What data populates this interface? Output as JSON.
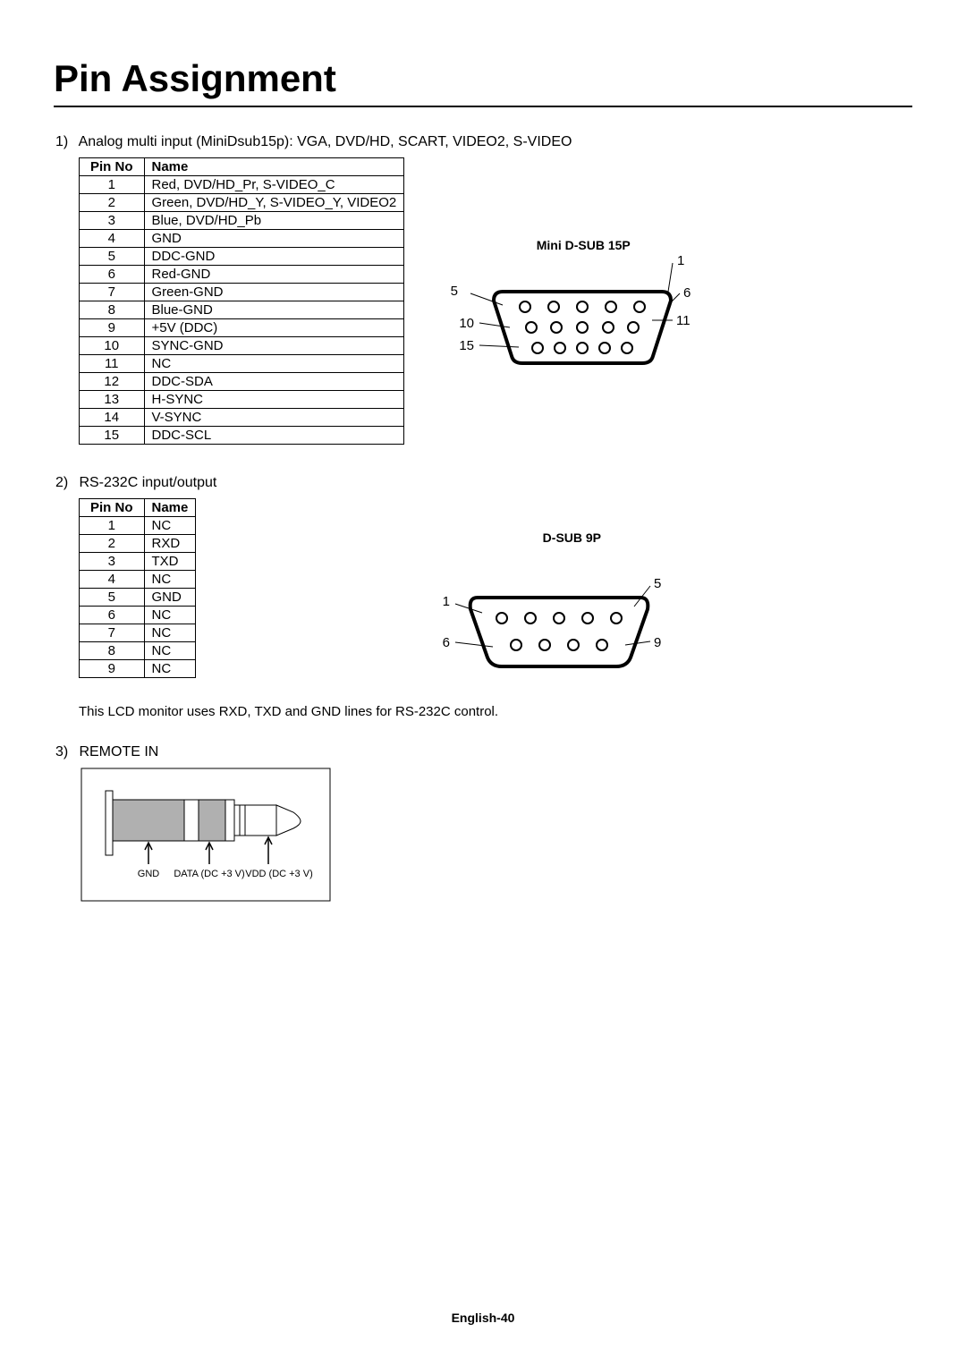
{
  "title": "Pin Assignment",
  "section1": {
    "number": "1)",
    "heading": "Analog multi input (MiniDsub15p): VGA, DVD/HD, SCART, VIDEO2, S-VIDEO",
    "table_headers": [
      "Pin No",
      "Name"
    ],
    "rows": [
      {
        "pin": "1",
        "name": "Red, DVD/HD_Pr, S-VIDEO_C"
      },
      {
        "pin": "2",
        "name": "Green, DVD/HD_Y, S-VIDEO_Y, VIDEO2"
      },
      {
        "pin": "3",
        "name": "Blue, DVD/HD_Pb"
      },
      {
        "pin": "4",
        "name": "GND"
      },
      {
        "pin": "5",
        "name": "DDC-GND"
      },
      {
        "pin": "6",
        "name": "Red-GND"
      },
      {
        "pin": "7",
        "name": "Green-GND"
      },
      {
        "pin": "8",
        "name": "Blue-GND"
      },
      {
        "pin": "9",
        "name": "+5V (DDC)"
      },
      {
        "pin": "10",
        "name": "SYNC-GND"
      },
      {
        "pin": "11",
        "name": "NC"
      },
      {
        "pin": "12",
        "name": "DDC-SDA"
      },
      {
        "pin": "13",
        "name": "H-SYNC"
      },
      {
        "pin": "14",
        "name": "V-SYNC"
      },
      {
        "pin": "15",
        "name": "DDC-SCL"
      }
    ],
    "diagram": {
      "title": "Mini D-SUB 15P",
      "callouts_left": [
        "5",
        "10",
        "15"
      ],
      "callouts_right": [
        "1",
        "6",
        "11"
      ]
    }
  },
  "section2": {
    "number": "2)",
    "heading": "RS-232C input/output",
    "table_headers": [
      "Pin No",
      "Name"
    ],
    "rows": [
      {
        "pin": "1",
        "name": "NC"
      },
      {
        "pin": "2",
        "name": "RXD"
      },
      {
        "pin": "3",
        "name": "TXD"
      },
      {
        "pin": "4",
        "name": "NC"
      },
      {
        "pin": "5",
        "name": "GND"
      },
      {
        "pin": "6",
        "name": "NC"
      },
      {
        "pin": "7",
        "name": "NC"
      },
      {
        "pin": "8",
        "name": "NC"
      },
      {
        "pin": "9",
        "name": "NC"
      }
    ],
    "diagram": {
      "title": "D-SUB 9P",
      "callouts_left": [
        "1",
        "6"
      ],
      "callouts_right": [
        "5",
        "9"
      ]
    },
    "note": "This LCD monitor uses RXD, TXD and GND lines for RS-232C control."
  },
  "section3": {
    "number": "3)",
    "heading": "REMOTE IN",
    "labels": [
      "GND",
      "DATA (DC +3 V)",
      "VDD (DC +3 V)"
    ]
  },
  "footer": "English-40"
}
